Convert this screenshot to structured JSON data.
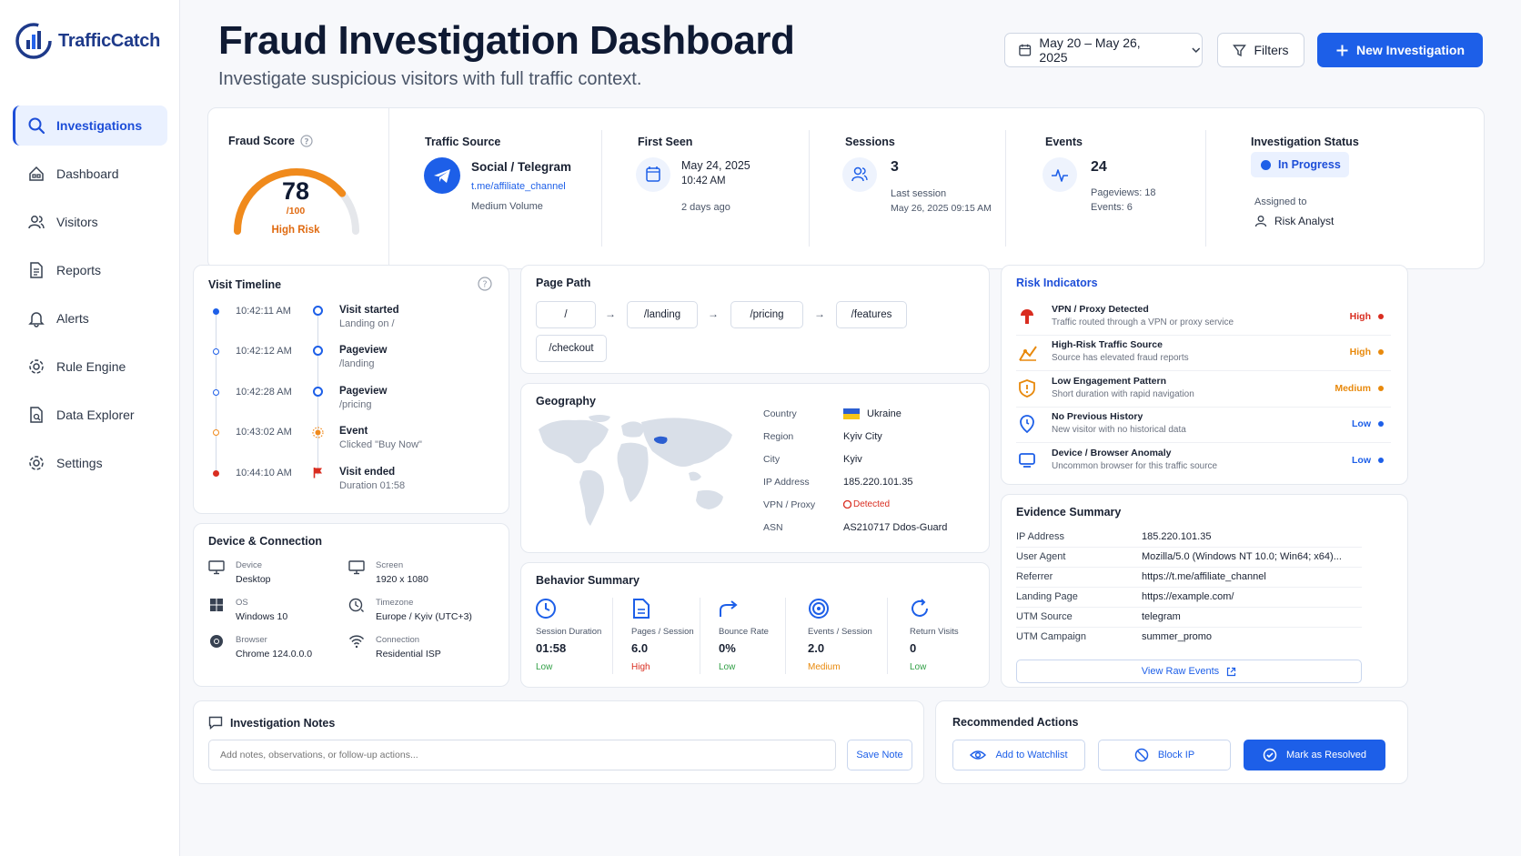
{
  "brand": {
    "name": "TrafficCatch"
  },
  "sidebar": {
    "items": [
      {
        "label": "Investigations"
      },
      {
        "label": "Dashboard"
      },
      {
        "label": "Visitors"
      },
      {
        "label": "Reports"
      },
      {
        "label": "Alerts"
      },
      {
        "label": "Rule Engine"
      },
      {
        "label": "Data Explorer"
      },
      {
        "label": "Settings"
      }
    ]
  },
  "header": {
    "title": "Fraud Investigation Dashboard",
    "subtitle": "Investigate suspicious visitors with full traffic context.",
    "date_range": "May 20 – May 26, 2025",
    "filters_label": "Filters",
    "new_label": "New Investigation"
  },
  "summary": {
    "fraud_score": {
      "label": "Fraud Score",
      "value": "78",
      "max": "/100",
      "score": 78,
      "risk": "High Risk"
    },
    "traffic_source": {
      "label": "Traffic Source",
      "name": "Social / Telegram",
      "link": "t.me/affiliate_channel",
      "volume": "Medium Volume"
    },
    "first_seen": {
      "label": "First Seen",
      "date": "May 24, 2025",
      "time": "10:42 AM",
      "ago": "2 days ago"
    },
    "sessions": {
      "label": "Sessions",
      "value": "3",
      "last_label": "Last session",
      "last_value": "May 26, 2025 09:15 AM"
    },
    "events": {
      "label": "Events",
      "value": "24",
      "pageviews": "Pageviews: 18",
      "events_line": "Events: 6"
    },
    "status": {
      "label": "Investigation Status",
      "value": "In Progress",
      "assigned_label": "Assigned to",
      "assignee": "Risk Analyst"
    }
  },
  "timeline": {
    "title": "Visit Timeline",
    "items": [
      {
        "time": "10:42:11 AM",
        "title": "Visit started",
        "desc": "Landing on /"
      },
      {
        "time": "10:42:12 AM",
        "title": "Pageview",
        "desc": "/landing"
      },
      {
        "time": "10:42:28 AM",
        "title": "Pageview",
        "desc": "/pricing"
      },
      {
        "time": "10:43:02 AM",
        "title": "Event",
        "desc": "Clicked \"Buy Now\""
      },
      {
        "time": "10:44:10 AM",
        "title": "Visit ended",
        "desc": "Duration 01:58"
      }
    ]
  },
  "device": {
    "title": "Device & Connection",
    "items": [
      {
        "label": "Device",
        "value": "Desktop"
      },
      {
        "label": "Screen",
        "value": "1920 x 1080"
      },
      {
        "label": "OS",
        "value": "Windows 10"
      },
      {
        "label": "Timezone",
        "value": "Europe / Kyiv (UTC+3)"
      },
      {
        "label": "Browser",
        "value": "Chrome 124.0.0.0"
      },
      {
        "label": "Connection",
        "value": "Residential ISP"
      }
    ]
  },
  "page_path": {
    "title": "Page Path",
    "steps": [
      "/",
      "/landing",
      "/pricing",
      "/features",
      "/checkout"
    ],
    "arrow": "→"
  },
  "geography": {
    "title": "Geography",
    "rows": [
      {
        "label": "Country",
        "value": "Ukraine"
      },
      {
        "label": "Region",
        "value": "Kyiv City"
      },
      {
        "label": "City",
        "value": "Kyiv"
      },
      {
        "label": "IP Address",
        "value": "185.220.101.35"
      },
      {
        "label": "VPN / Proxy",
        "value": "Detected"
      },
      {
        "label": "ASN",
        "value": "AS210717 Ddos-Guard"
      }
    ]
  },
  "behavior": {
    "title": "Behavior Summary",
    "metrics": [
      {
        "label": "Session Duration",
        "value": "01:58",
        "level": "Low"
      },
      {
        "label": "Pages / Session",
        "value": "6.0",
        "level": "High"
      },
      {
        "label": "Bounce Rate",
        "value": "0%",
        "level": "Low"
      },
      {
        "label": "Events / Session",
        "value": "2.0",
        "level": "Medium"
      },
      {
        "label": "Return Visits",
        "value": "0",
        "level": "Low"
      }
    ]
  },
  "risk": {
    "title": "Risk Indicators",
    "items": [
      {
        "title": "VPN / Proxy Detected",
        "desc": "Traffic routed through a VPN or proxy service",
        "level": "High"
      },
      {
        "title": "High-Risk Traffic Source",
        "desc": "Source has elevated fraud reports",
        "level": "High"
      },
      {
        "title": "Low Engagement Pattern",
        "desc": "Short duration with rapid navigation",
        "level": "Medium"
      },
      {
        "title": "No Previous History",
        "desc": "New visitor with no historical data",
        "level": "Low"
      },
      {
        "title": "Device / Browser Anomaly",
        "desc": "Uncommon browser for this traffic source",
        "level": "Low"
      }
    ]
  },
  "evidence": {
    "title": "Evidence Summary",
    "rows": [
      {
        "key": "IP Address",
        "value": "185.220.101.35"
      },
      {
        "key": "User Agent",
        "value": "Mozilla/5.0 (Windows NT 10.0; Win64; x64)..."
      },
      {
        "key": "Referrer",
        "value": "https://t.me/affiliate_channel"
      },
      {
        "key": "Landing Page",
        "value": "https://example.com/"
      },
      {
        "key": "UTM Source",
        "value": "telegram"
      },
      {
        "key": "UTM Campaign",
        "value": "summer_promo"
      }
    ],
    "button": "View Raw Events"
  },
  "notes": {
    "title": "Investigation Notes",
    "placeholder": "Add notes, observations, or follow-up actions...",
    "save": "Save Note"
  },
  "actions": {
    "title": "Recommended Actions",
    "watchlist": "Add to Watchlist",
    "block": "Block IP",
    "resolve": "Mark as Resolved"
  },
  "colors": {
    "accent": "#1d5fe8",
    "high": "#d92d20",
    "medium": "#e8890c",
    "low": "#1d5fe8",
    "good": "#2f9e44"
  }
}
